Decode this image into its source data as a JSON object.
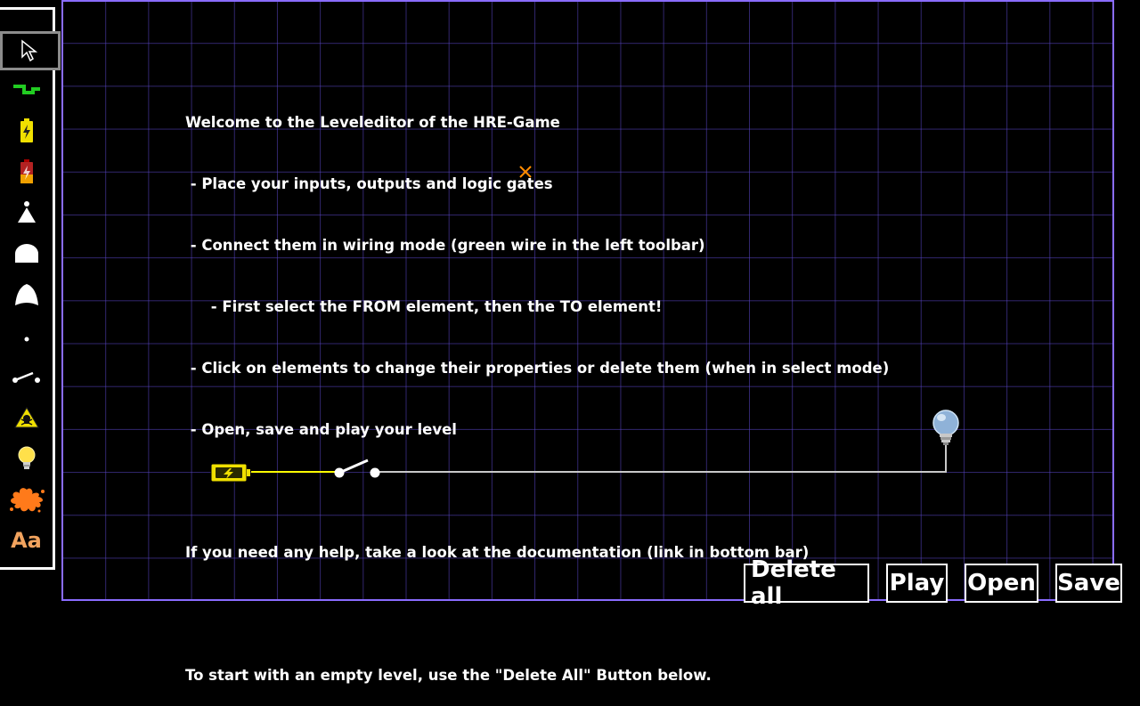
{
  "toolbar": {
    "tools": [
      {
        "name": "select-tool",
        "icon": "cursor-arrow-icon",
        "selected": true
      },
      {
        "name": "wire-tool",
        "icon": "green-wire-icon"
      },
      {
        "name": "battery-tool",
        "icon": "battery-icon"
      },
      {
        "name": "dead-battery-tool",
        "icon": "battery-empty-icon"
      },
      {
        "name": "not-gate-tool",
        "icon": "not-gate-icon"
      },
      {
        "name": "and-gate-tool",
        "icon": "and-gate-icon"
      },
      {
        "name": "or-gate-tool",
        "icon": "or-gate-icon"
      },
      {
        "name": "junction-tool",
        "icon": "dot-icon"
      },
      {
        "name": "switch-tool",
        "icon": "switch-icon"
      },
      {
        "name": "danger-tool",
        "icon": "skull-warning-icon"
      },
      {
        "name": "lamp-tool",
        "icon": "lightbulb-icon"
      },
      {
        "name": "splash-tool",
        "icon": "splash-icon"
      },
      {
        "name": "text-tool",
        "icon": "text-icon",
        "label": "Aa"
      }
    ]
  },
  "instructions": {
    "line1": "Welcome to the Leveleditor of the HRE-Game",
    "line2": " - Place your inputs, outputs and logic gates",
    "line3": " - Connect them in wiring mode (green wire in the left toolbar)",
    "line4": "     - First select the FROM element, then the TO element!",
    "line5": " - Click on elements to change their properties or delete them (when in select mode)",
    "line6": " - Open, save and play your level",
    "line7": "",
    "line8": "If you need any help, take a look at the documentation (link in bottom bar)",
    "line9": "",
    "line10": "To start with an empty level, use the \"Delete All\" Button below."
  },
  "buttons": {
    "delete_all": "Delete all",
    "play": "Play",
    "open": "Open",
    "save": "Save"
  },
  "colors": {
    "grid": "#5a46c8",
    "border": "#8a6cff",
    "wire_active": "#ffff00",
    "wire_inactive": "#c8c8c8",
    "battery": "#f0e000",
    "marker": "#ff8c00",
    "text_tool": "#f2a35e"
  }
}
